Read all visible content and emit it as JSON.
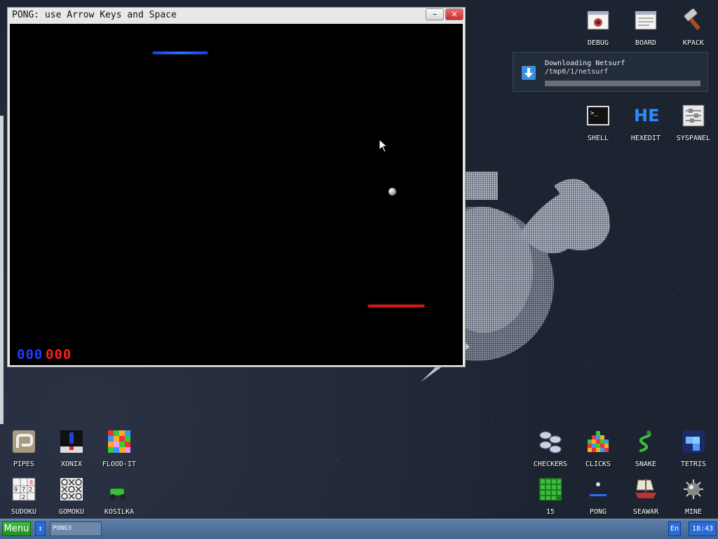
{
  "window": {
    "title": "PONG: use Arrow Keys and Space",
    "minimize_label": "–",
    "close_label": "×"
  },
  "game": {
    "score_blue": "000",
    "score_red": "000",
    "colors": {
      "blue": "#1f3cff",
      "red": "#ff1f1f",
      "background": "#000000"
    }
  },
  "notification": {
    "title": "Downloading Netsurf",
    "path": "/tmp0/1/netsurf",
    "progress_fraction": 0.0
  },
  "desktop_icons": {
    "debug": "DEBUG",
    "board": "BOARD",
    "kpack": "KPACK",
    "shell": "SHELL",
    "hexedit": "HEXEDIT",
    "hexedit_glyph": "HE",
    "syspanel": "SYSPANEL",
    "pipes": "PIPES",
    "xonix": "XONIX",
    "flood_it": "FLOOD-IT",
    "sudoku": "SUDOKU",
    "gomoku": "GOMOKU",
    "kosilka": "KOSILKA",
    "checkers": "CHECKERS",
    "clicks": "CLICKS",
    "snake": "SNAKE",
    "tetris": "TETRIS",
    "fifteen": "15",
    "pong": "PONG",
    "seawar": "SEAWAR",
    "mine": "MINE"
  },
  "taskbar": {
    "menu_label": "Menu",
    "swap_label": "↕",
    "task_label": "PONG3",
    "language": "En",
    "clock": "18:43"
  }
}
